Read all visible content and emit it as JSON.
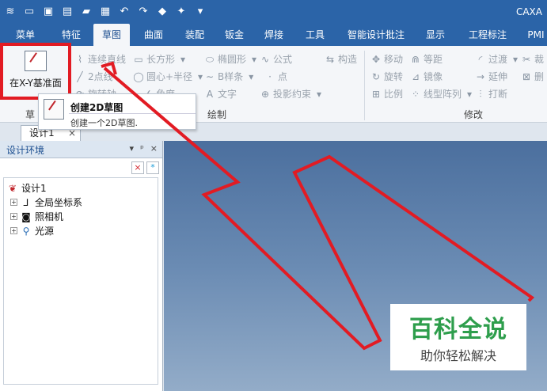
{
  "titlebar": {
    "app_title": "CAXA",
    "quick_access": [
      "app-menu-icon",
      "new-icon",
      "open-icon",
      "save-as-icon",
      "folder-icon",
      "save-icon",
      "undo-icon",
      "redo-icon",
      "render-icon",
      "wand-icon",
      "dropdown-icon"
    ]
  },
  "tabs": [
    {
      "label": "菜单"
    },
    {
      "label": "特征"
    },
    {
      "label": "草图"
    },
    {
      "label": "曲面"
    },
    {
      "label": "装配"
    },
    {
      "label": "钣金"
    },
    {
      "label": "焊接"
    },
    {
      "label": "工具"
    },
    {
      "label": "智能设计批注"
    },
    {
      "label": "显示"
    },
    {
      "label": "工程标注"
    },
    {
      "label": "PMI"
    }
  ],
  "ribbon": {
    "big_button": "在X-Y基准面",
    "draw_group": {
      "label": "绘制",
      "items": [
        "连续直线",
        "长方形",
        "椭圆形",
        "公式",
        "构造",
        "2点线",
        "圆心+半径",
        "B样条",
        "点",
        "旋转轴",
        "角度",
        "文字",
        "投影约束"
      ]
    },
    "modify_group": {
      "label": "修改",
      "items": [
        "移动",
        "等距",
        "过渡",
        "裁",
        "旋转",
        "镜像",
        "延伸",
        "删",
        "比例",
        "线型阵列",
        "打断"
      ]
    },
    "sketch_group_label": "草"
  },
  "tooltip": {
    "title": "创建2D草图",
    "description": "创建一个2D草图."
  },
  "doc_tab": {
    "label": "设计1",
    "close": "×"
  },
  "panel": {
    "title": "设计环境",
    "controls": [
      "▾",
      "ᵖ",
      "×"
    ],
    "tools": [
      "×",
      "*"
    ],
    "tree": [
      {
        "label": "设计1",
        "icon": "design-icon"
      },
      {
        "label": "全局坐标系",
        "icon": "axis-icon"
      },
      {
        "label": "照相机",
        "icon": "camera-icon"
      },
      {
        "label": "光源",
        "icon": "light-icon"
      }
    ]
  },
  "watermark": {
    "title": "百科全说",
    "subtitle": "助你轻松解决"
  },
  "colors": {
    "titlebar": "#2b64a8",
    "highlight": "#e21b23",
    "brand_green": "#2e9e4c"
  }
}
